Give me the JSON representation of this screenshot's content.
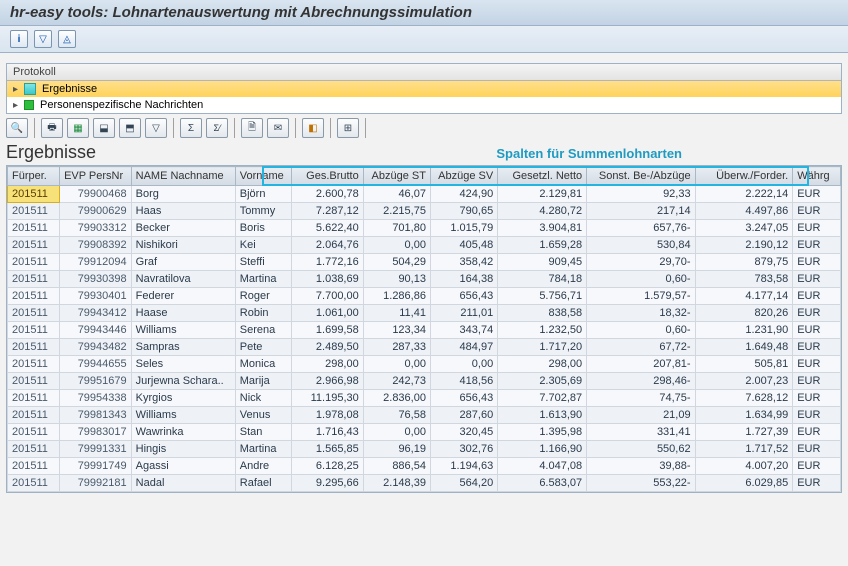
{
  "title": "hr-easy tools: Lohnartenauswertung mit Abrechnungssimulation",
  "protokoll": {
    "label": "Protokoll",
    "ergebnisse": "Ergebnisse",
    "personen": "Personenspezifische Nachrichten"
  },
  "section": {
    "ergebnisse": "Ergebnisse",
    "spalten": "Spalten für Summenlohnarten"
  },
  "columns": {
    "c0": "Fürper.",
    "c1": "EVP PersNr",
    "c2": "NAME Nachname",
    "c3": "Vorname",
    "c4": "Ges.Brutto",
    "c5": "Abzüge ST",
    "c6": "Abzüge SV",
    "c7": "Gesetzl. Netto",
    "c8": "Sonst. Be-/Abzüge",
    "c9": "Überw./Forder.",
    "c10": "Währg"
  },
  "rows": [
    {
      "per": "201511",
      "nr": "79900468",
      "nach": "Borg",
      "vor": "Björn",
      "brutto": "2.600,78",
      "st": "46,07",
      "sv": "424,90",
      "netto": "2.129,81",
      "sonst": "92,33",
      "ueber": "2.222,14",
      "w": "EUR"
    },
    {
      "per": "201511",
      "nr": "79900629",
      "nach": "Haas",
      "vor": "Tommy",
      "brutto": "7.287,12",
      "st": "2.215,75",
      "sv": "790,65",
      "netto": "4.280,72",
      "sonst": "217,14",
      "ueber": "4.497,86",
      "w": "EUR"
    },
    {
      "per": "201511",
      "nr": "79903312",
      "nach": "Becker",
      "vor": "Boris",
      "brutto": "5.622,40",
      "st": "701,80",
      "sv": "1.015,79",
      "netto": "3.904,81",
      "sonst": "657,76-",
      "ueber": "3.247,05",
      "w": "EUR"
    },
    {
      "per": "201511",
      "nr": "79908392",
      "nach": "Nishikori",
      "vor": "Kei",
      "brutto": "2.064,76",
      "st": "0,00",
      "sv": "405,48",
      "netto": "1.659,28",
      "sonst": "530,84",
      "ueber": "2.190,12",
      "w": "EUR"
    },
    {
      "per": "201511",
      "nr": "79912094",
      "nach": "Graf",
      "vor": "Steffi",
      "brutto": "1.772,16",
      "st": "504,29",
      "sv": "358,42",
      "netto": "909,45",
      "sonst": "29,70-",
      "ueber": "879,75",
      "w": "EUR"
    },
    {
      "per": "201511",
      "nr": "79930398",
      "nach": "Navratilova",
      "vor": "Martina",
      "brutto": "1.038,69",
      "st": "90,13",
      "sv": "164,38",
      "netto": "784,18",
      "sonst": "0,60-",
      "ueber": "783,58",
      "w": "EUR"
    },
    {
      "per": "201511",
      "nr": "79930401",
      "nach": "Federer",
      "vor": "Roger",
      "brutto": "7.700,00",
      "st": "1.286,86",
      "sv": "656,43",
      "netto": "5.756,71",
      "sonst": "1.579,57-",
      "ueber": "4.177,14",
      "w": "EUR"
    },
    {
      "per": "201511",
      "nr": "79943412",
      "nach": "Haase",
      "vor": "Robin",
      "brutto": "1.061,00",
      "st": "11,41",
      "sv": "211,01",
      "netto": "838,58",
      "sonst": "18,32-",
      "ueber": "820,26",
      "w": "EUR"
    },
    {
      "per": "201511",
      "nr": "79943446",
      "nach": "Williams",
      "vor": "Serena",
      "brutto": "1.699,58",
      "st": "123,34",
      "sv": "343,74",
      "netto": "1.232,50",
      "sonst": "0,60-",
      "ueber": "1.231,90",
      "w": "EUR"
    },
    {
      "per": "201511",
      "nr": "79943482",
      "nach": "Sampras",
      "vor": "Pete",
      "brutto": "2.489,50",
      "st": "287,33",
      "sv": "484,97",
      "netto": "1.717,20",
      "sonst": "67,72-",
      "ueber": "1.649,48",
      "w": "EUR"
    },
    {
      "per": "201511",
      "nr": "79944655",
      "nach": "Seles",
      "vor": "Monica",
      "brutto": "298,00",
      "st": "0,00",
      "sv": "0,00",
      "netto": "298,00",
      "sonst": "207,81-",
      "ueber": "505,81",
      "w": "EUR"
    },
    {
      "per": "201511",
      "nr": "79951679",
      "nach": "Jurjewna Schara..",
      "vor": "Marija",
      "brutto": "2.966,98",
      "st": "242,73",
      "sv": "418,56",
      "netto": "2.305,69",
      "sonst": "298,46-",
      "ueber": "2.007,23",
      "w": "EUR"
    },
    {
      "per": "201511",
      "nr": "79954338",
      "nach": "Kyrgios",
      "vor": "Nick",
      "brutto": "11.195,30",
      "st": "2.836,00",
      "sv": "656,43",
      "netto": "7.702,87",
      "sonst": "74,75-",
      "ueber": "7.628,12",
      "w": "EUR"
    },
    {
      "per": "201511",
      "nr": "79981343",
      "nach": "Williams",
      "vor": "Venus",
      "brutto": "1.978,08",
      "st": "76,58",
      "sv": "287,60",
      "netto": "1.613,90",
      "sonst": "21,09",
      "ueber": "1.634,99",
      "w": "EUR"
    },
    {
      "per": "201511",
      "nr": "79983017",
      "nach": "Wawrinka",
      "vor": "Stan",
      "brutto": "1.716,43",
      "st": "0,00",
      "sv": "320,45",
      "netto": "1.395,98",
      "sonst": "331,41",
      "ueber": "1.727,39",
      "w": "EUR"
    },
    {
      "per": "201511",
      "nr": "79991331",
      "nach": "Hingis",
      "vor": "Martina",
      "brutto": "1.565,85",
      "st": "96,19",
      "sv": "302,76",
      "netto": "1.166,90",
      "sonst": "550,62",
      "ueber": "1.717,52",
      "w": "EUR"
    },
    {
      "per": "201511",
      "nr": "79991749",
      "nach": "Agassi",
      "vor": "Andre",
      "brutto": "6.128,25",
      "st": "886,54",
      "sv": "1.194,63",
      "netto": "4.047,08",
      "sonst": "39,88-",
      "ueber": "4.007,20",
      "w": "EUR"
    },
    {
      "per": "201511",
      "nr": "79992181",
      "nach": "Nadal",
      "vor": "Rafael",
      "brutto": "9.295,66",
      "st": "2.148,39",
      "sv": "564,20",
      "netto": "6.583,07",
      "sonst": "553,22-",
      "ueber": "6.029,85",
      "w": "EUR"
    }
  ]
}
